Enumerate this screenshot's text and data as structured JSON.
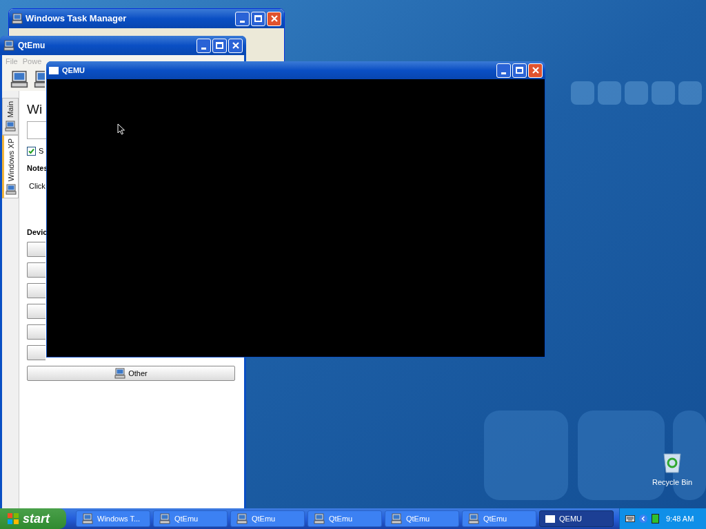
{
  "desktop": {
    "icons": [
      {
        "label": "Recycle Bin"
      }
    ]
  },
  "task_manager": {
    "title": "Windows Task Manager"
  },
  "qtemu": {
    "title": "QtEmu",
    "menu": [
      "File",
      "Powe"
    ],
    "tabs": [
      {
        "label": "Main",
        "selected": false
      },
      {
        "label": "Windows XP",
        "selected": true
      }
    ],
    "heading": "Wi",
    "checkbox": {
      "label": "S",
      "checked": true
    },
    "notes_label": "Notes",
    "notes_text": "Click",
    "devices_label": "Devic",
    "device_buttons": [
      {
        "kind": "blank"
      },
      {
        "kind": "blank"
      },
      {
        "kind": "blank"
      },
      {
        "kind": "blank"
      },
      {
        "kind": "blank"
      },
      {
        "kind": "blank"
      },
      {
        "kind": "labeled",
        "label": "Other"
      }
    ]
  },
  "qemu": {
    "title": "QEMU"
  },
  "taskbar": {
    "start": "start",
    "tasks": [
      {
        "label": "Windows T...",
        "kind": "taskmgr",
        "selected": false
      },
      {
        "label": "QtEmu",
        "kind": "qtemu",
        "selected": false
      },
      {
        "label": "QtEmu",
        "kind": "qtemu",
        "selected": false
      },
      {
        "label": "QtEmu",
        "kind": "qtemu",
        "selected": false
      },
      {
        "label": "QtEmu",
        "kind": "qtemu",
        "selected": false
      },
      {
        "label": "QtEmu",
        "kind": "qtemu",
        "selected": false
      },
      {
        "label": "QEMU",
        "kind": "qemu",
        "selected": true
      }
    ],
    "clock": "9:48 AM"
  }
}
